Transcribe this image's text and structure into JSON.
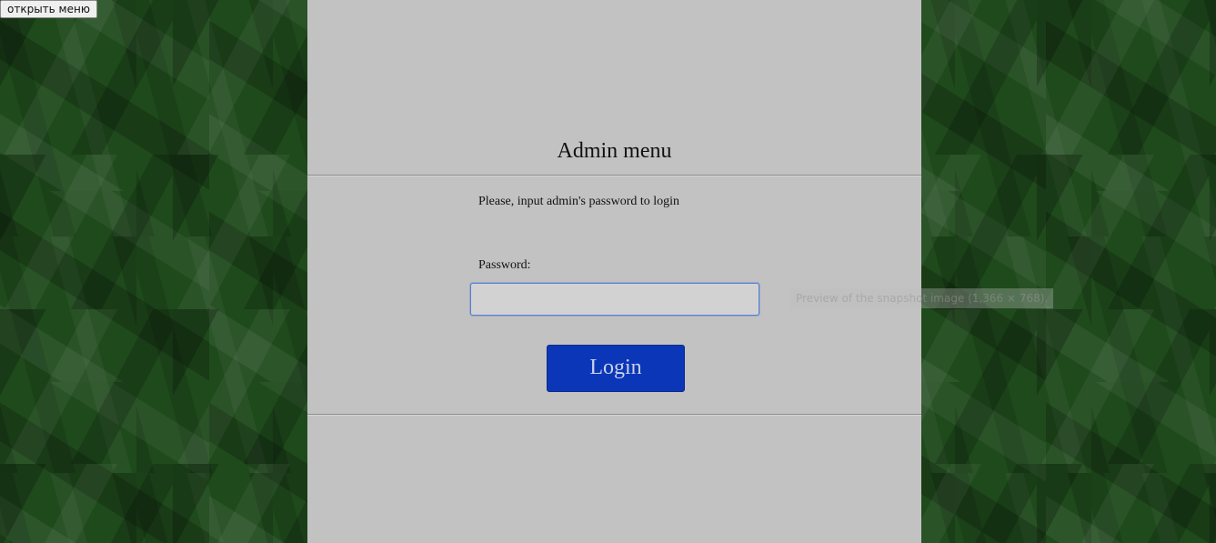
{
  "menu_toggle": {
    "label": "открыть меню"
  },
  "panel": {
    "title": "Admin menu",
    "prompt": "Please, input admin's password to login",
    "password_label": "Password:",
    "password_value": "",
    "login_label": "Login"
  },
  "tooltip": {
    "text": "Preview of the snapshot image (1,366 × 768)."
  },
  "colors": {
    "background": "#1f4a1c",
    "panel": "#c2c2c2",
    "login_button": "#0b36b8",
    "input_focus_border": "#5b7fd4"
  }
}
